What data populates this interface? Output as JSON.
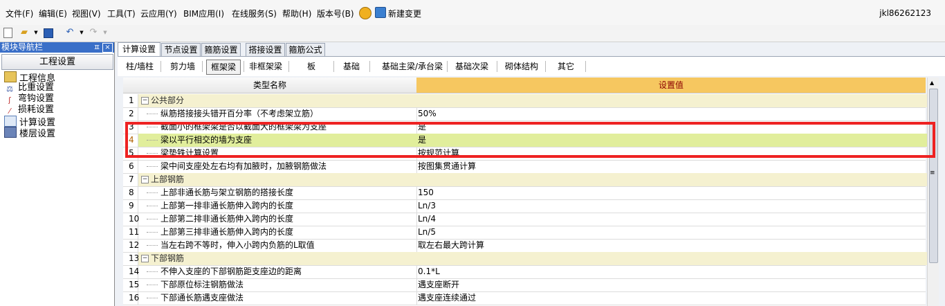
{
  "menubar": {
    "items": [
      "文件(F)",
      "编辑(E)",
      "视图(V)",
      "工具(T)",
      "云应用(Y)",
      "BIM应用(I)",
      "在线服务(S)",
      "帮助(H)",
      "版本号(B)"
    ],
    "change_label": "新建变更",
    "user": "jkl86262123"
  },
  "toolbar": {
    "icons": [
      "new-file-icon",
      "open-folder-icon",
      "save-icon",
      "undo-icon",
      "redo-icon"
    ]
  },
  "nav": {
    "title": "模块导航栏",
    "pin": "ㅍ",
    "close": "×",
    "header": "工程设置",
    "items": [
      {
        "label": "工程信息",
        "icon": "project-info-icon"
      },
      {
        "label": "比重设置",
        "icon": "weight-icon"
      },
      {
        "label": "弯钩设置",
        "icon": "hook-icon"
      },
      {
        "label": "损耗设置",
        "icon": "loss-icon"
      },
      {
        "label": "计算设置",
        "icon": "calc-icon"
      },
      {
        "label": "楼层设置",
        "icon": "floor-icon"
      }
    ]
  },
  "tabs": [
    "计算设置",
    "节点设置",
    "箍筋设置",
    "搭接设置",
    "箍筋公式"
  ],
  "subtabs": [
    "柱/墙柱",
    "剪力墙",
    "框架梁",
    "非框架梁",
    "板",
    "基础",
    "基础主梁/承台梁",
    "基础次梁",
    "砌体结构",
    "其它"
  ],
  "grid": {
    "col_name": "类型名称",
    "col_value": "设置值",
    "rows": [
      {
        "n": "1",
        "name": "公共部分",
        "value": ""
      },
      {
        "n": "2",
        "name": "纵筋搭接接头错开百分率（不考虑架立筋）",
        "value": "50%"
      },
      {
        "n": "3",
        "name": "截面小的框架梁是否以截面大的框架梁为支座",
        "value": "是"
      },
      {
        "n": "4",
        "name": "梁以平行相交的墙为支座",
        "value": "是"
      },
      {
        "n": "5",
        "name": "梁垫铁计算设置",
        "value": "按规范计算"
      },
      {
        "n": "6",
        "name": "梁中间支座处左右均有加腋时，加腋钢筋做法",
        "value": "按图集贯通计算"
      },
      {
        "n": "7",
        "name": "上部钢筋",
        "value": ""
      },
      {
        "n": "8",
        "name": "上部非通长筋与架立钢筋的搭接长度",
        "value": "150"
      },
      {
        "n": "9",
        "name": "上部第一排非通长筋伸入跨内的长度",
        "value": "Ln/3"
      },
      {
        "n": "10",
        "name": "上部第二排非通长筋伸入跨内的长度",
        "value": "Ln/4"
      },
      {
        "n": "11",
        "name": "上部第三排非通长筋伸入跨内的长度",
        "value": "Ln/5"
      },
      {
        "n": "12",
        "name": "当左右跨不等时，伸入小跨内负筋的L取值",
        "value": "取左右最大跨计算"
      },
      {
        "n": "13",
        "name": "下部钢筋",
        "value": ""
      },
      {
        "n": "14",
        "name": "不伸入支座的下部钢筋距支座边的距离",
        "value": "0.1*L"
      },
      {
        "n": "15",
        "name": "下部原位标注钢筋做法",
        "value": "遇支座断开"
      },
      {
        "n": "16",
        "name": "下部通长筋遇支座做法",
        "value": "遇支座连续通过"
      }
    ]
  }
}
